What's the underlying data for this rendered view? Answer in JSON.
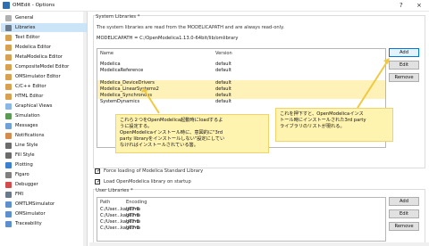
{
  "window": {
    "title": "OMEdit - Options",
    "help_glyph": "?",
    "close_glyph": "×"
  },
  "sidebar": {
    "items": [
      {
        "label": "General",
        "icon_color": "#b0b0b0"
      },
      {
        "label": "Libraries",
        "icon_color": "#6a7a8a",
        "selected": true
      },
      {
        "label": "Text Editor",
        "icon_color": "#d8a14f"
      },
      {
        "label": "Modelica Editor",
        "icon_color": "#d8a14f"
      },
      {
        "label": "MetaModelica Editor",
        "icon_color": "#d8a14f"
      },
      {
        "label": "CompositeModel Editor",
        "icon_color": "#d8a14f"
      },
      {
        "label": "OMSimulator Editor",
        "icon_color": "#d8a14f"
      },
      {
        "label": "C/C++ Editor",
        "icon_color": "#d8a14f"
      },
      {
        "label": "HTML Editor",
        "icon_color": "#d8a14f"
      },
      {
        "label": "Graphical Views",
        "icon_color": "#8bb7e6"
      },
      {
        "label": "Simulation",
        "icon_color": "#5a9b53"
      },
      {
        "label": "Messages",
        "icon_color": "#6fa0d8"
      },
      {
        "label": "Notifications",
        "icon_color": "#d38c4d"
      },
      {
        "label": "Line Style",
        "icon_color": "#6b6b6b"
      },
      {
        "label": "Fill Style",
        "icon_color": "#6b6b6b"
      },
      {
        "label": "Plotting",
        "icon_color": "#3b7fd0"
      },
      {
        "label": "Figaro",
        "icon_color": "#7f7f7f"
      },
      {
        "label": "Debugger",
        "icon_color": "#d44b4b"
      },
      {
        "label": "FMI",
        "icon_color": "#6a7a8a"
      },
      {
        "label": "OMTLMSimulator",
        "icon_color": "#5d8fcf"
      },
      {
        "label": "OMSimulator",
        "icon_color": "#5d8fcf"
      },
      {
        "label": "Traceability",
        "icon_color": "#5d8fcf"
      }
    ]
  },
  "libraries": {
    "system_title": "System Libraries *",
    "system_info": "The system libraries are read from the MODELICAPATH and are always read-only.",
    "modelica_path": "MODELICAPATH = C:/OpenModelica1.13.0-64bit/lib/omlibrary",
    "table_headers": {
      "name": "Name",
      "version": "Version"
    },
    "system_rows": [
      {
        "name": "Modelica",
        "version": "default",
        "highlight": false
      },
      {
        "name": "ModelicaReference",
        "version": "default",
        "highlight": false
      },
      {
        "name": "Modelica_DeviceDrivers",
        "version": "default",
        "highlight": true
      },
      {
        "name": "Modelica_LinearSystems2",
        "version": "default",
        "highlight": true
      },
      {
        "name": "Modelica_Synchronous",
        "version": "default",
        "highlight": true
      },
      {
        "name": "SystemDynamics",
        "version": "default",
        "highlight": false
      }
    ],
    "buttons": {
      "add": "Add",
      "edit": "Edit",
      "remove": "Remove"
    },
    "checkbox_force": "Force loading of Modelica Standard Library",
    "checkbox_load": "Load OpenModelica library on startup",
    "user_title": "User Libraries *",
    "user_headers": {
      "path": "Path",
      "encoding": "Encoding"
    },
    "user_rows": [
      {
        "path": "C:/User...kage.mo",
        "encoding": "UTF-8"
      },
      {
        "path": "C:/User...kage.mo",
        "encoding": "UTF-8"
      },
      {
        "path": "C:/User...kage.mo",
        "encoding": "UTF-8"
      },
      {
        "path": "C:/User...kage.mo",
        "encoding": "UTF-8"
      }
    ],
    "user_buttons": {
      "add": "Add",
      "edit": "Edit",
      "remove": "Remove"
    }
  },
  "annotations": {
    "left_note": [
      "これら２つをOpenModelica起動時にloadするよ",
      "うに設定する。",
      "OpenModelicaインストール時に、意図的に\"3rd",
      "party libraryをインストールしない\"設定にしてい",
      "なければインストールされている筈。"
    ],
    "right_note": [
      "これを押下すと、OpenModelicaインス",
      "トール時にインストールされた3rd party",
      "ライブラリのリストが現れる。"
    ]
  }
}
